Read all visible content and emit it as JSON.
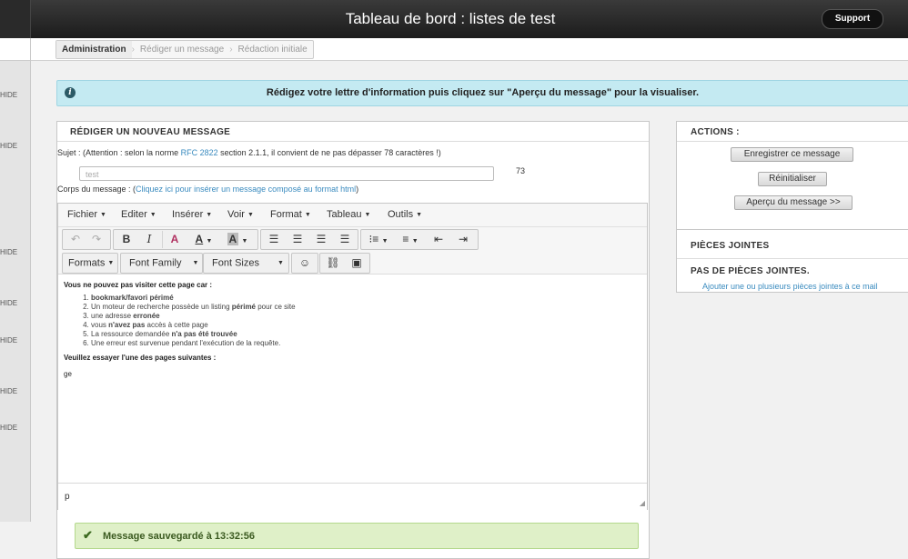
{
  "header": {
    "title": "Tableau de bord : listes de test",
    "support_label": "Support"
  },
  "sidebar": {
    "items": [
      "HIDE",
      "HIDE",
      "HIDE",
      "HIDE",
      "HIDE",
      "HIDE",
      "HIDE"
    ]
  },
  "breadcrumb": [
    "Administration",
    "Rédiger un message",
    "Rédaction initiale"
  ],
  "info_banner": {
    "text": "Rédigez votre lettre d'information puis cliquez sur \"Aperçu du message\" pour la visualiser."
  },
  "compose": {
    "title": "RÉDIGER UN NOUVEAU MESSAGE",
    "subject_note_pre": "Sujet : (Attention : selon la norme ",
    "subject_note_link": "RFC 2822",
    "subject_note_post": " section 2.1.1, il convient de ne pas dépasser 78 caractères !)",
    "subject_value": "test",
    "char_count": "73",
    "body_note_pre": "Corps du message : (",
    "body_note_link": "Cliquez ici pour insérer un message composé au format html",
    "body_note_post": ")"
  },
  "editor": {
    "menus": [
      "Fichier",
      "Editer",
      "Insérer",
      "Voir",
      "Format",
      "Tableau",
      "Outils"
    ],
    "dropdowns": {
      "formats": "Formats",
      "font_family": "Font Family",
      "font_sizes": "Font Sizes"
    },
    "content": {
      "heading": "Vous ne pouvez pas visiter cette page car :",
      "items": [
        {
          "pre": "",
          "bold": "bookmark/favori périmé",
          "post": ""
        },
        {
          "pre": "Un moteur de recherche possède un listing ",
          "bold": "périmé",
          "post": " pour ce site"
        },
        {
          "pre": "une adresse ",
          "bold": "erronée",
          "post": ""
        },
        {
          "pre": "vous ",
          "bold": "n'avez pas",
          "post": " accès à cette page"
        },
        {
          "pre": "La ressource demandée ",
          "bold": "n'a pas été trouvée",
          "post": ""
        },
        {
          "pre": "Une erreur est survenue pendant l'exécution de la requête.",
          "bold": "",
          "post": ""
        }
      ],
      "suggest": "Veuillez essayer l'une des pages suivantes :",
      "trailing": "ge"
    },
    "status_path": "p"
  },
  "success": {
    "text": "Message sauvegardé à 13:32:56"
  },
  "actions": {
    "title": "ACTIONS :",
    "buttons": [
      "Enregistrer ce message",
      "Réinitialiser",
      "Aperçu du message >>"
    ]
  },
  "attachments": {
    "title": "PIÈCES JOINTES",
    "empty": "PAS DE PIÈCES JOINTES.",
    "add_link": "Ajouter une ou plusieurs pièces jointes à ce mail"
  }
}
